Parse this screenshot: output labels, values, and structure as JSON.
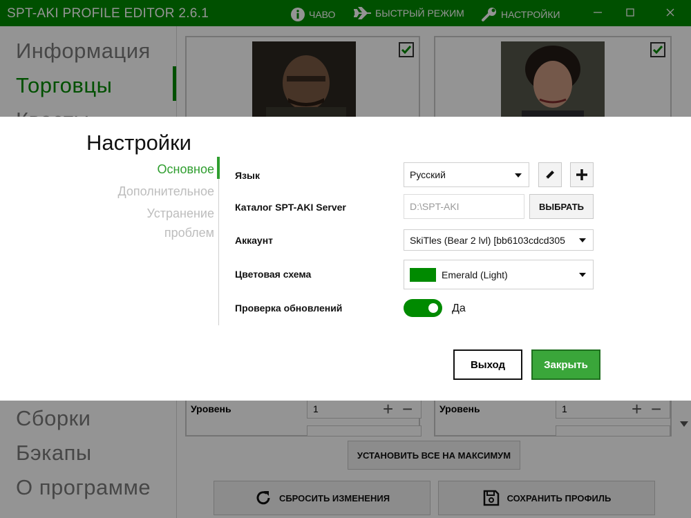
{
  "titlebar": {
    "app_title": "SPT-AKI PROFILE EDITOR  2.6.1",
    "faq_label": "ЧАВО",
    "fast_mode_label": "БЫСТРЫЙ РЕЖИМ",
    "settings_label": "НАСТРОЙКИ",
    "accent_color": "#008a00"
  },
  "nav": {
    "items": [
      "Информация",
      "Торговцы",
      "Квесты",
      "Сборки",
      "Бэкапы",
      "О программе"
    ],
    "active": "Торговцы"
  },
  "traders": {
    "level_label": "Уровень",
    "level_value": "1"
  },
  "actions": {
    "max_all": "УСТАНОВИТЬ ВСЕ НА МАКСИМУМ",
    "reset": "СБРОСИТЬ ИЗМЕНЕНИЯ",
    "save": "СОХРАНИТЬ ПРОФИЛЬ"
  },
  "dialog": {
    "title": "Настройки",
    "tabs": [
      "Основное",
      "Дополнительное",
      "Устранение проблем"
    ],
    "active_tab": "Основное",
    "language": {
      "label": "Язык",
      "value": "Русский"
    },
    "server_dir": {
      "label": "Каталог SPT-AKI Server",
      "placeholder": "D:\\SPT-AKI",
      "browse": "ВЫБРАТЬ"
    },
    "account": {
      "label": "Аккаунт",
      "value": "SkiTles (Bear 2 lvl) [bb6103cdcd305"
    },
    "color_scheme": {
      "label": "Цветовая схема",
      "value": "Emerald (Light)",
      "swatch": "#008a00"
    },
    "updates": {
      "label": "Проверка обновлений",
      "state": "Да"
    },
    "exit_button": "Выход",
    "close_button": "Закрыть",
    "close_color": "#3aa63a"
  }
}
